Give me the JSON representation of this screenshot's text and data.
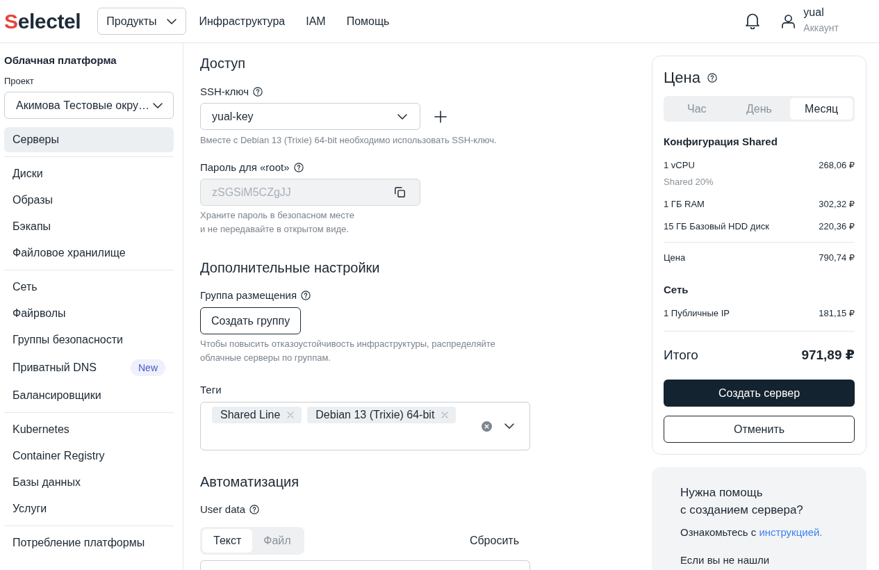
{
  "header": {
    "logo": "Selectel",
    "nav": [
      {
        "label": "Продукты",
        "kind": "dropdown"
      },
      {
        "label": "Инфраструктура",
        "kind": "link"
      },
      {
        "label": "IAM",
        "kind": "link"
      },
      {
        "label": "Помощь",
        "kind": "link"
      }
    ],
    "account": {
      "name": "yual",
      "caption": "Аккаунт"
    }
  },
  "sidebar": {
    "title": "Облачная платформа",
    "project": {
      "label": "Проект",
      "value": "Акимова Тестовые окру…"
    },
    "groups": [
      {
        "items": [
          {
            "label": "Серверы",
            "selected": true
          }
        ]
      },
      {
        "items": [
          {
            "label": "Диски",
            "selected": false
          },
          {
            "label": "Образы",
            "selected": false
          },
          {
            "label": "Бэкапы",
            "selected": false
          },
          {
            "label": "Файловое хранилище",
            "selected": false
          }
        ]
      },
      {
        "items": [
          {
            "label": "Сеть",
            "selected": false
          },
          {
            "label": "Файрволы",
            "selected": false
          },
          {
            "label": "Группы безопасности",
            "selected": false
          },
          {
            "label": "Приватный DNS",
            "selected": false,
            "badge": "New"
          },
          {
            "label": "Балансировщики",
            "selected": false
          }
        ]
      },
      {
        "items": [
          {
            "label": "Kubernetes",
            "selected": false
          },
          {
            "label": "Container Registry",
            "selected": false
          },
          {
            "label": "Базы данных",
            "selected": false
          },
          {
            "label": "Услуги",
            "selected": false
          }
        ]
      },
      {
        "items": [
          {
            "label": "Потребление платформы",
            "selected": false
          }
        ]
      }
    ]
  },
  "form": {
    "access": {
      "heading": "Доступ",
      "ssh_key": {
        "label": "SSH-ключ",
        "value": "yual-key",
        "hint": "Вместе с Debian 13 (Trixie) 64-bit необходимо использовать SSH-ключ."
      },
      "root_password": {
        "label": "Пароль для «root»",
        "value": "zSGSiM5CZgJJ",
        "disabled": true,
        "hint": "Храните пароль в безопасном месте\nи не передавайте в открытом виде."
      }
    },
    "additional": {
      "heading": "Дополнительные настройки",
      "placement_group": {
        "label": "Группа размещения",
        "button": "Создать группу",
        "hint": "Чтобы повысить отказоустойчивость инфраструктуры, распределяйте облачные серверы по группам."
      },
      "tags": {
        "label": "Теги",
        "items": [
          "Shared Line",
          "Debian 13 (Trixie) 64-bit"
        ]
      }
    },
    "automation": {
      "heading": "Автоматизация",
      "user_data": {
        "label": "User data",
        "modes": [
          {
            "label": "Текст",
            "selected": true
          },
          {
            "label": "Файл",
            "selected": false
          }
        ],
        "reset": "Сбросить"
      }
    }
  },
  "price": {
    "title": "Цена",
    "periods": [
      {
        "label": "Час",
        "selected": false
      },
      {
        "label": "День",
        "selected": false
      },
      {
        "label": "Месяц",
        "selected": true
      }
    ],
    "sections": [
      {
        "title": "Конфигурация Shared",
        "lines": [
          {
            "label": "1 vCPU",
            "amount": "268,06 ₽",
            "note": "Shared 20%"
          },
          {
            "label": "1 ГБ RAM",
            "amount": "302,32 ₽"
          },
          {
            "label": "15 ГБ Базовый HDD диск",
            "amount": "220,36 ₽"
          }
        ],
        "subtotal": {
          "label": "Цена",
          "amount": "790,74 ₽"
        }
      },
      {
        "title": "Сеть",
        "lines": [
          {
            "label": "1 Публичные IP",
            "amount": "181,15 ₽"
          }
        ]
      }
    ],
    "total": {
      "label": "Итого",
      "amount": "971,89 ₽"
    },
    "buttons": [
      {
        "label": "Создать сервер",
        "kind": "primary"
      },
      {
        "label": "Отменить",
        "kind": "secondary"
      }
    ]
  },
  "help": {
    "title": "Нужна помощь\nс созданием сервера?",
    "paragraphs": [
      {
        "text": "Ознакомьтесь с",
        "link": "инструкцией."
      },
      {
        "text": "Если вы не нашли"
      }
    ]
  }
}
